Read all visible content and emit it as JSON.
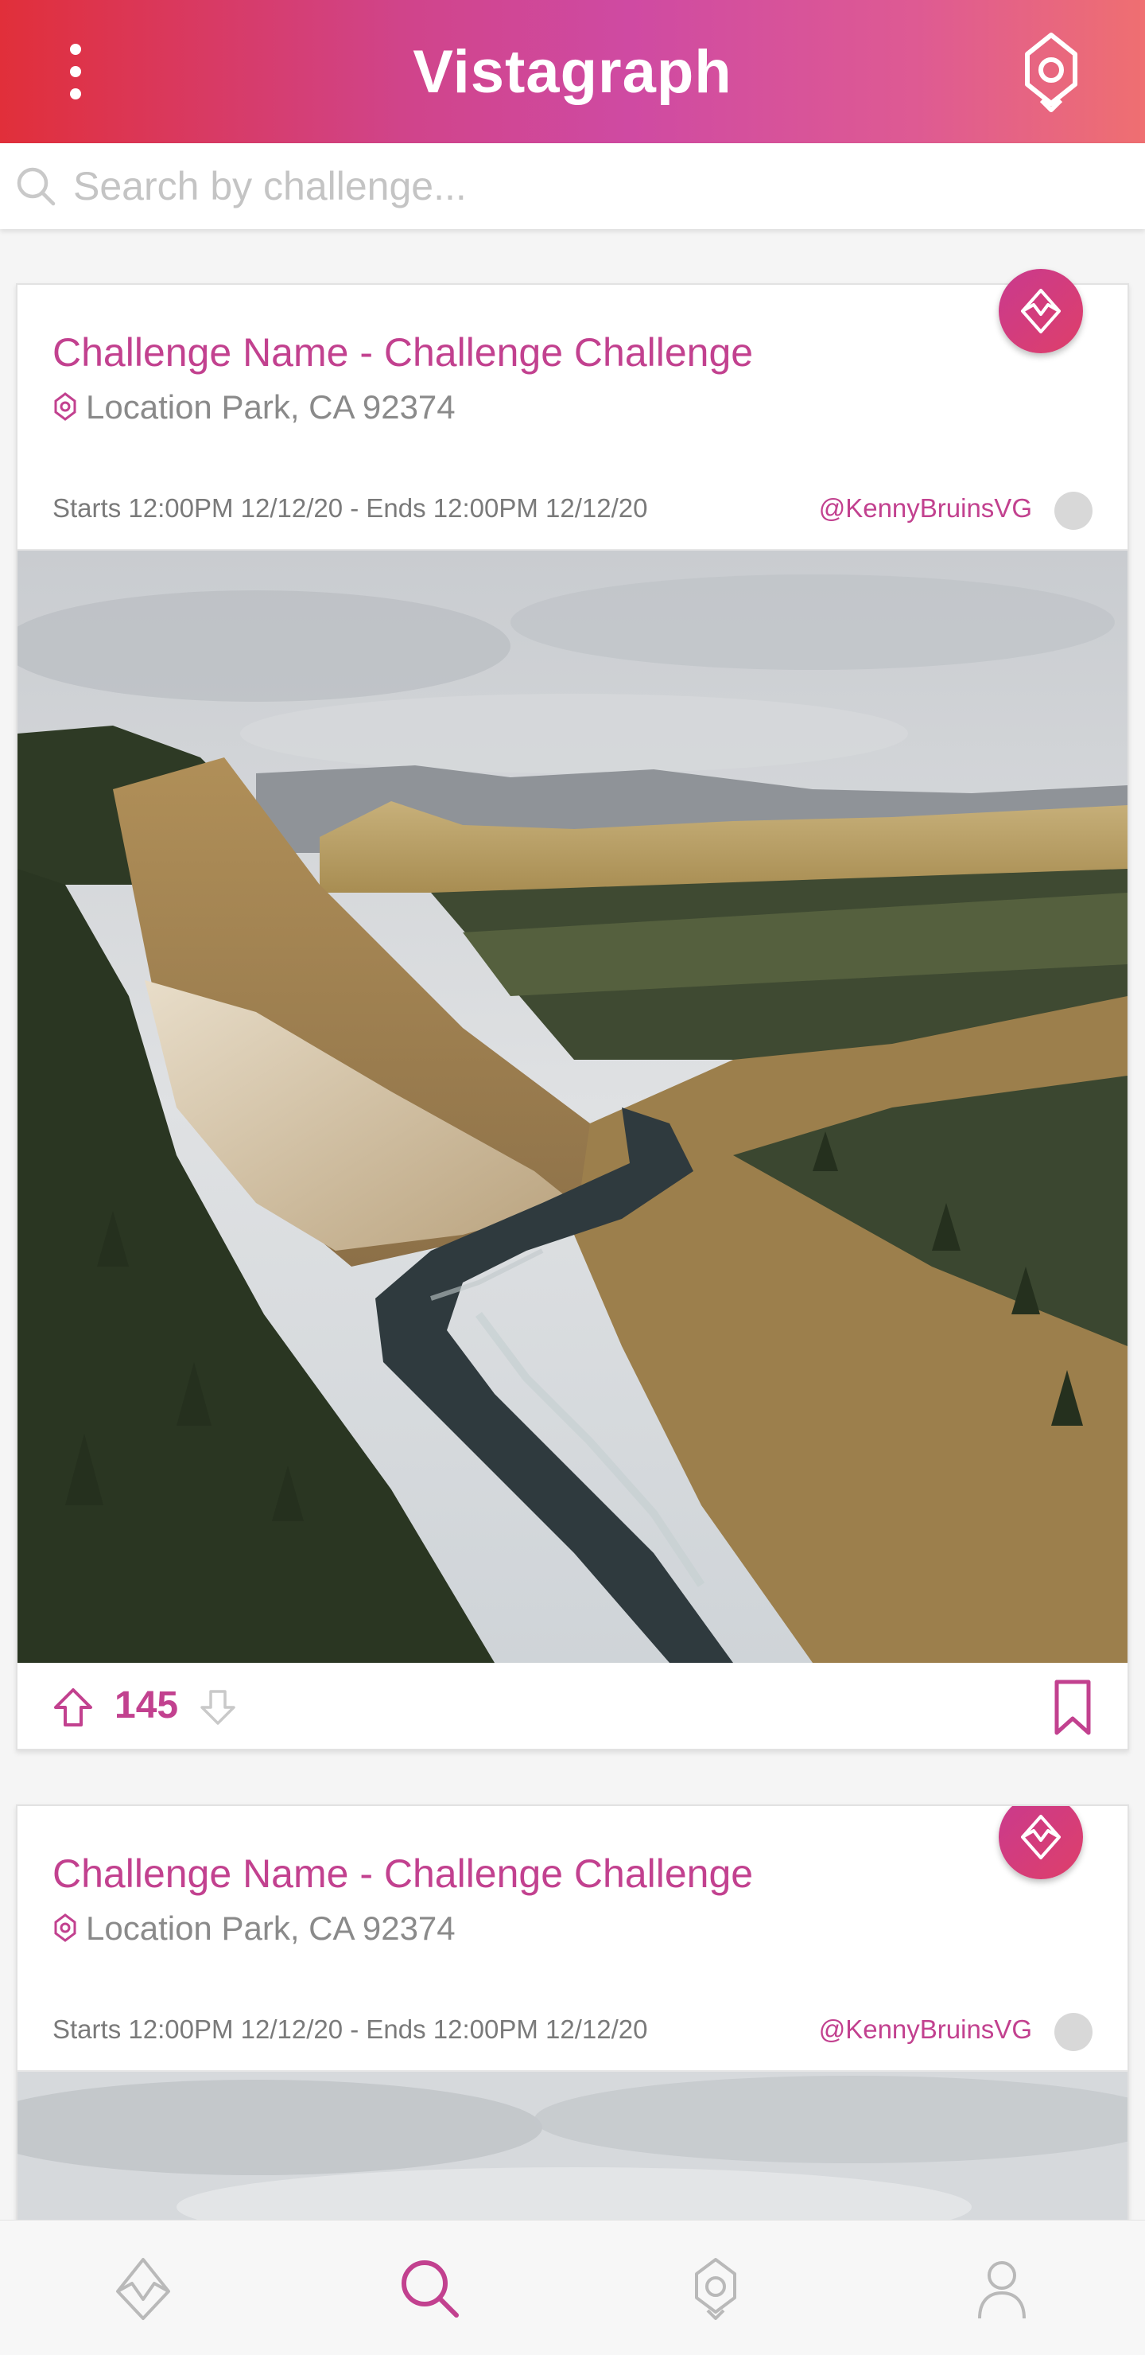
{
  "app": {
    "title": "Vistagraph",
    "brand_gradient": [
      "#e12f3a",
      "#cf4aa2",
      "#ef6f71"
    ],
    "accent_color": "#c2418f"
  },
  "header": {
    "menu_icon": "more-vertical-icon",
    "right_icon": "location-pin-icon"
  },
  "search": {
    "placeholder": "Search by challenge...",
    "value": "",
    "icon": "search-icon"
  },
  "cards": [
    {
      "title": "Challenge Name - Challenge Challenge",
      "location": "Location Park, CA 92374",
      "dates": "Starts 12:00PM 12/12/20 - Ends 12:00PM 12/12/20",
      "user": "@KennyBruinsVG",
      "badge_icon": "mountain-crystal-icon",
      "votes": "145",
      "image_description_icon": "landscape-photo"
    },
    {
      "title": "Challenge Name - Challenge Challenge",
      "location": "Location Park, CA 92374",
      "dates": "Starts 12:00PM 12/12/20 - Ends 12:00PM 12/12/20",
      "user": "@KennyBruinsVG",
      "badge_icon": "mountain-crystal-icon"
    }
  ],
  "bottom_nav": {
    "items": [
      {
        "icon": "challenges-icon",
        "active": false
      },
      {
        "icon": "search-icon",
        "active": true
      },
      {
        "icon": "location-pin-icon",
        "active": false
      },
      {
        "icon": "profile-icon",
        "active": false
      }
    ]
  }
}
